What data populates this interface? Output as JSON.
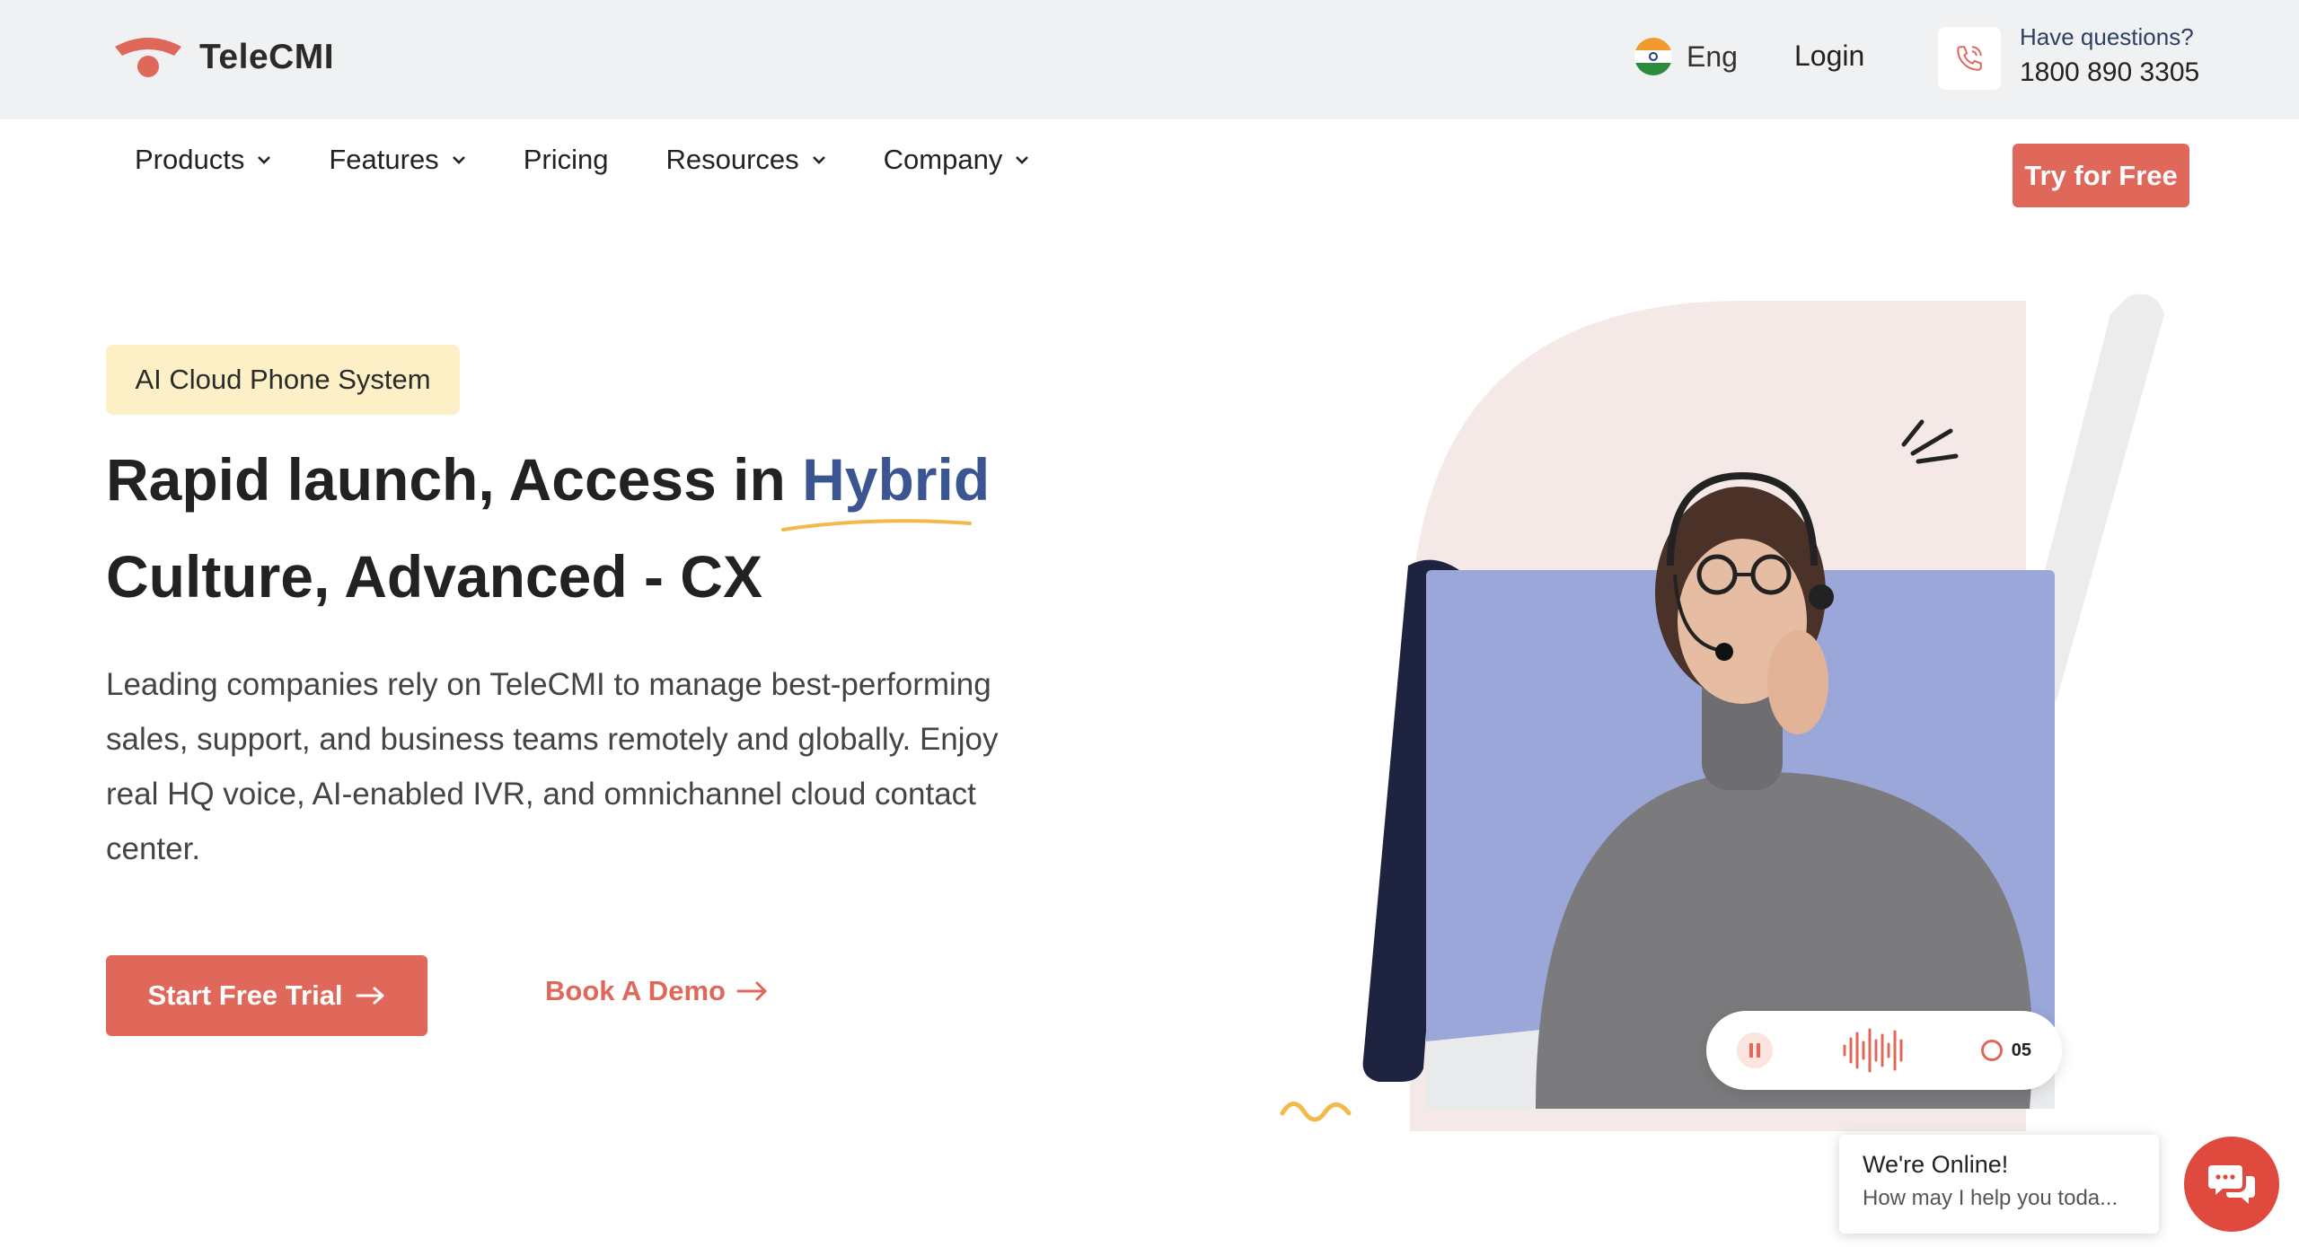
{
  "brand": {
    "name": "TeleCMI"
  },
  "topbar": {
    "language": "Eng",
    "login": "Login",
    "questions_label": "Have questions?",
    "phone_number": "1800 890 3305"
  },
  "nav": {
    "items": [
      {
        "label": "Products",
        "dropdown": true
      },
      {
        "label": "Features",
        "dropdown": true
      },
      {
        "label": "Pricing",
        "dropdown": false
      },
      {
        "label": "Resources",
        "dropdown": true
      },
      {
        "label": "Company",
        "dropdown": true
      }
    ],
    "cta": "Try for Free"
  },
  "hero": {
    "badge": "AI Cloud Phone System",
    "headline_part1": "Rapid launch, Access in ",
    "headline_highlight": "Hybrid",
    "headline_part2": "Culture, Advanced - CX",
    "description": "Leading companies rely on TeleCMI to manage best-performing sales, support, and business teams remotely and globally. Enjoy real HQ voice, AI-enabled IVR, and omnichannel cloud contact center.",
    "primary_button": "Start Free Trial",
    "secondary_link": "Book A Demo",
    "call_timer": "05"
  },
  "chat": {
    "title": "We're Online!",
    "subtitle": "How may I help you toda..."
  },
  "colors": {
    "accent": "#e0685a",
    "highlight": "#3b5592",
    "badge_bg": "#fdefc6",
    "topbar_bg": "#f0f1f3",
    "photo_bg": "#9aa7d8"
  }
}
